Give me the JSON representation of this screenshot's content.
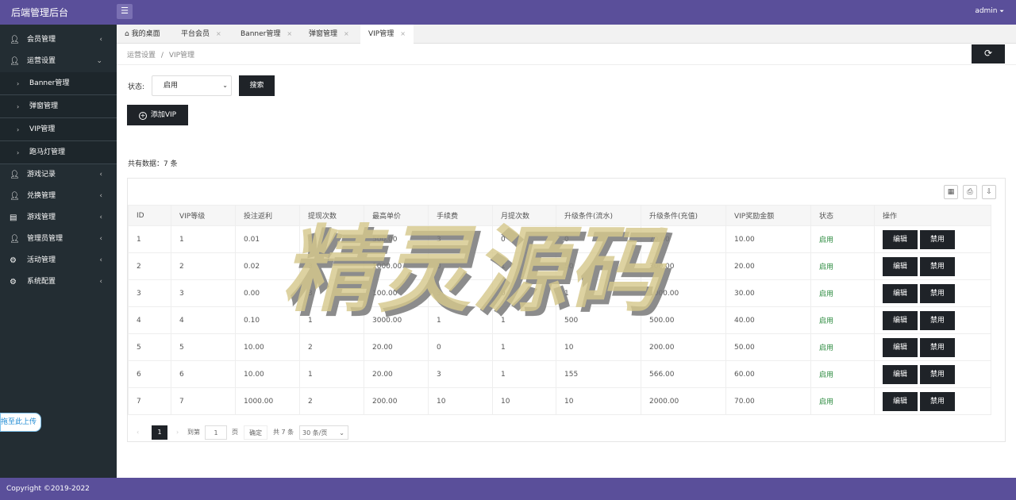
{
  "app": {
    "title": "后端管理后台",
    "user": "admin",
    "menu_icon": "☰",
    "user_caret": "⏷"
  },
  "sidebar": {
    "items": [
      {
        "label": "会员管理",
        "icon": "user-icon",
        "arrow": "‹"
      },
      {
        "label": "运营设置",
        "icon": "user-icon",
        "arrow": "⌄"
      },
      {
        "label": "游戏记录",
        "icon": "user-icon",
        "arrow": "‹"
      },
      {
        "label": "兑换管理",
        "icon": "user-icon",
        "arrow": "‹"
      },
      {
        "label": "游戏管理",
        "icon": "game-icon",
        "arrow": "‹"
      },
      {
        "label": "管理员管理",
        "icon": "admin-icon",
        "arrow": "‹"
      },
      {
        "label": "活动管理",
        "icon": "gear-icon",
        "arrow": "‹"
      },
      {
        "label": "系统配置",
        "icon": "gear-icon",
        "arrow": "‹"
      }
    ],
    "subitems": [
      {
        "label": "Banner管理",
        "arrow": "›"
      },
      {
        "label": "弹窗管理",
        "arrow": "›"
      },
      {
        "label": "VIP管理",
        "arrow": "›"
      },
      {
        "label": "跑马灯管理",
        "arrow": "›"
      }
    ],
    "upload_tip": "拖至此上传"
  },
  "tabs": [
    {
      "label": "我的桌面",
      "close": ""
    },
    {
      "label": "平台会员",
      "close": "×"
    },
    {
      "label": "Banner管理",
      "close": "×"
    },
    {
      "label": "弹窗管理",
      "close": "×"
    },
    {
      "label": "VIP管理",
      "close": "×"
    }
  ],
  "home_icon_glyph": "⌂",
  "breadcrumb": {
    "parent": "运营设置",
    "separator": "/",
    "current": "VIP管理"
  },
  "refresh_icon": "⟳",
  "filter": {
    "status_label": "状态:",
    "status_value": "启用",
    "status_caret": "⌄",
    "search_button": "搜索"
  },
  "add_button": {
    "label": "添加VIP",
    "icon": "+"
  },
  "total_text": "共有数据：7 条",
  "toolbar_glyphs": {
    "columns": "▦",
    "print": "⎙",
    "export": "⇩"
  },
  "table": {
    "headers": [
      "ID",
      "VIP等级",
      "投注返利",
      "提现次数",
      "最高单价",
      "手续费",
      "月提次数",
      "升级条件(流水)",
      "升级条件(充值)",
      "VIP奖励金额",
      "状态",
      "操作"
    ],
    "rows": [
      [
        "1",
        "1",
        "0.01",
        "1",
        "500.00",
        "3",
        "0",
        "0",
        "70.00",
        "10.00",
        "启用"
      ],
      [
        "2",
        "2",
        "0.02",
        "3",
        "1000.00",
        "0",
        "1",
        "50",
        "300.00",
        "20.00",
        "启用"
      ],
      [
        "3",
        "3",
        "0.00",
        "3",
        "100.00",
        "3",
        "0",
        "1",
        "1000.00",
        "30.00",
        "启用"
      ],
      [
        "4",
        "4",
        "0.10",
        "1",
        "3000.00",
        "1",
        "1",
        "500",
        "500.00",
        "40.00",
        "启用"
      ],
      [
        "5",
        "5",
        "10.00",
        "2",
        "20.00",
        "0",
        "1",
        "10",
        "200.00",
        "50.00",
        "启用"
      ],
      [
        "6",
        "6",
        "10.00",
        "1",
        "20.00",
        "3",
        "1",
        "155",
        "566.00",
        "60.00",
        "启用"
      ],
      [
        "7",
        "7",
        "1000.00",
        "2",
        "200.00",
        "10",
        "10",
        "10",
        "2000.00",
        "70.00",
        "启用"
      ]
    ],
    "edit_label": "编辑",
    "disable_label": "禁用"
  },
  "pagination": {
    "prev": "‹",
    "current_page": "1",
    "next": "›",
    "goto_label": "到第",
    "goto_value": "1",
    "page_unit": "页",
    "confirm": "确定",
    "total": "共 7 条",
    "page_size": "30 条/页",
    "page_size_caret": "⌄"
  },
  "watermark": "精灵源码",
  "footer": "Copyright ©2019-2022",
  "colors": {
    "header": "#5a4f9a",
    "sidebar": "#232d33",
    "button": "#1f2328",
    "status_green": "#2b8a3e"
  }
}
